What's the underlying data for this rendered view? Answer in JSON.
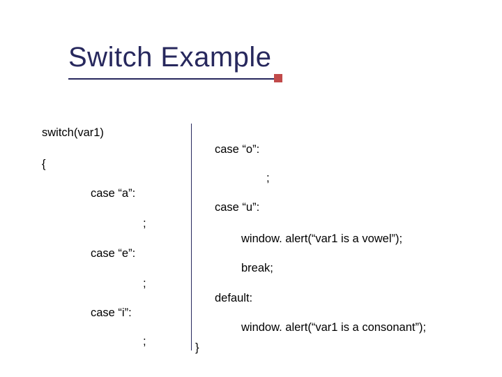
{
  "title": "Switch Example",
  "left": {
    "l1": "switch(var1)",
    "l2": "{",
    "l3": "case “a”:",
    "l4": ";",
    "l5": "case “e”:",
    "l6": ";",
    "l7": "case “i”:",
    "l8": ";"
  },
  "right": {
    "r1": "case “o”:",
    "r2": ";",
    "r3": "case “u”:",
    "r4": "window. alert(“var1 is a vowel”);",
    "r5": "break;",
    "r6": "default:",
    "r7": "window. alert(“var1 is a consonant”);",
    "r8": "}"
  }
}
